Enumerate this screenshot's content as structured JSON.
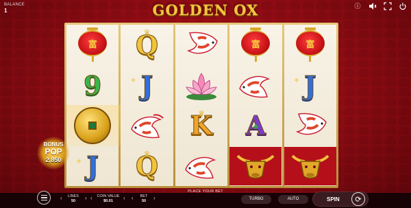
{
  "balance": {
    "label": "BALANCE",
    "value": "1"
  },
  "logo": {
    "text": "GOLDEN OX"
  },
  "top_icons": [
    "info-icon",
    "sound-icon",
    "fullscreen-icon",
    "power-icon"
  ],
  "reels": [
    [
      "lantern",
      "9",
      "coin",
      "J"
    ],
    [
      "Q",
      "J",
      "koi",
      "Q"
    ],
    [
      "koi",
      "lotus",
      "K",
      "koi"
    ],
    [
      "lantern",
      "koi",
      "A",
      "ox"
    ],
    [
      "lantern",
      "J",
      "koi",
      "ox"
    ]
  ],
  "lantern_char": "富",
  "bonus": {
    "line1": "BONUS",
    "line2": "POP",
    "value": "2,850"
  },
  "place_bet": "PLACE YOUR BET",
  "controls": {
    "lines": {
      "label": "LINES",
      "value": "50"
    },
    "coin_value": {
      "label": "COIN VALUE",
      "value": "$0.01"
    },
    "bet": {
      "label": "BET",
      "value": "50"
    },
    "turbo": "TURBO",
    "auto": "AUTO",
    "spin": "SPIN"
  },
  "colors": {
    "accent_gold": "#f5c542",
    "background_red": "#b3121a",
    "bar": "#170305"
  }
}
